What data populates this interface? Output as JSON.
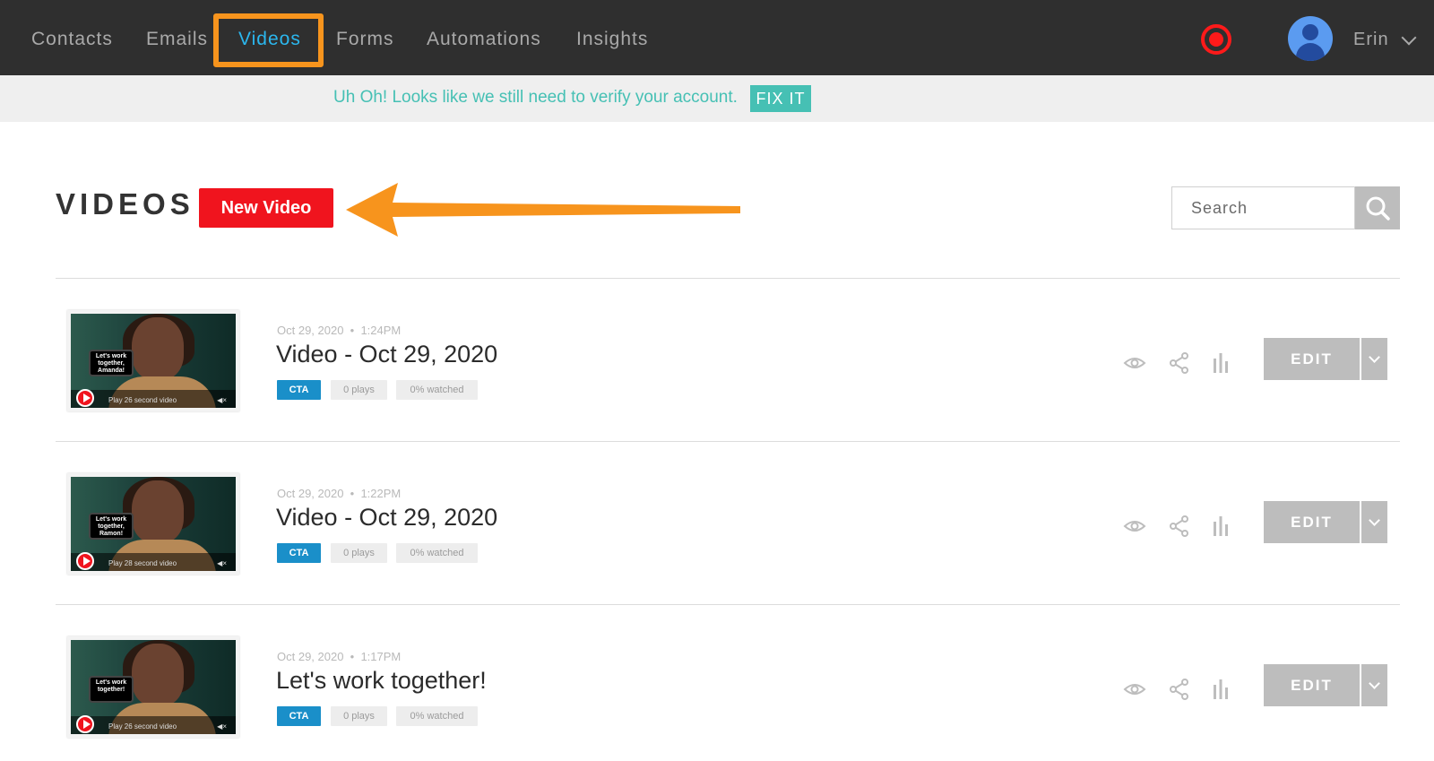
{
  "nav": {
    "items": [
      {
        "label": "Contacts"
      },
      {
        "label": "Emails"
      },
      {
        "label": "Videos",
        "active": true
      },
      {
        "label": "Forms"
      },
      {
        "label": "Automations"
      },
      {
        "label": "Insights"
      }
    ],
    "user_name": "Erin",
    "record_icon": "record-icon",
    "avatar_icon": "user-avatar-icon",
    "highlight_color": "#f7941d"
  },
  "banner": {
    "message": "Uh Oh! Looks like we still need to verify your account.",
    "fix_label": "FIX IT"
  },
  "header": {
    "title": "VIDEOS",
    "new_video_label": "New Video",
    "search_placeholder": "Search"
  },
  "videos": [
    {
      "date": "Oct 29, 2020",
      "time": "1:24PM",
      "title": "Video - Oct 29, 2020",
      "cta": "CTA",
      "plays": "0 plays",
      "watched": "0% watched",
      "thumb_caption": "Play 26 second video",
      "thumb_sign": "Let's work together, Amanda!"
    },
    {
      "date": "Oct 29, 2020",
      "time": "1:22PM",
      "title": "Video - Oct 29, 2020",
      "cta": "CTA",
      "plays": "0 plays",
      "watched": "0% watched",
      "thumb_caption": "Play 28 second video",
      "thumb_sign": "Let's work together, Ramon!"
    },
    {
      "date": "Oct 29, 2020",
      "time": "1:17PM",
      "title": "Let's work together!",
      "cta": "CTA",
      "plays": "0 plays",
      "watched": "0% watched",
      "thumb_caption": "Play 26 second video",
      "thumb_sign": "Let's work together!"
    }
  ],
  "row_actions": {
    "edit_label": "EDIT",
    "icons": [
      "eye-icon",
      "share-icon",
      "stats-icon",
      "chevron-down-icon"
    ]
  },
  "colors": {
    "nav_bg": "#2f2f2f",
    "active_nav": "#2bb7ee",
    "brand_red": "#f0141e",
    "banner_teal": "#46c0b4",
    "cta_blue": "#1a8fc9",
    "annotation_orange": "#f7941d"
  }
}
